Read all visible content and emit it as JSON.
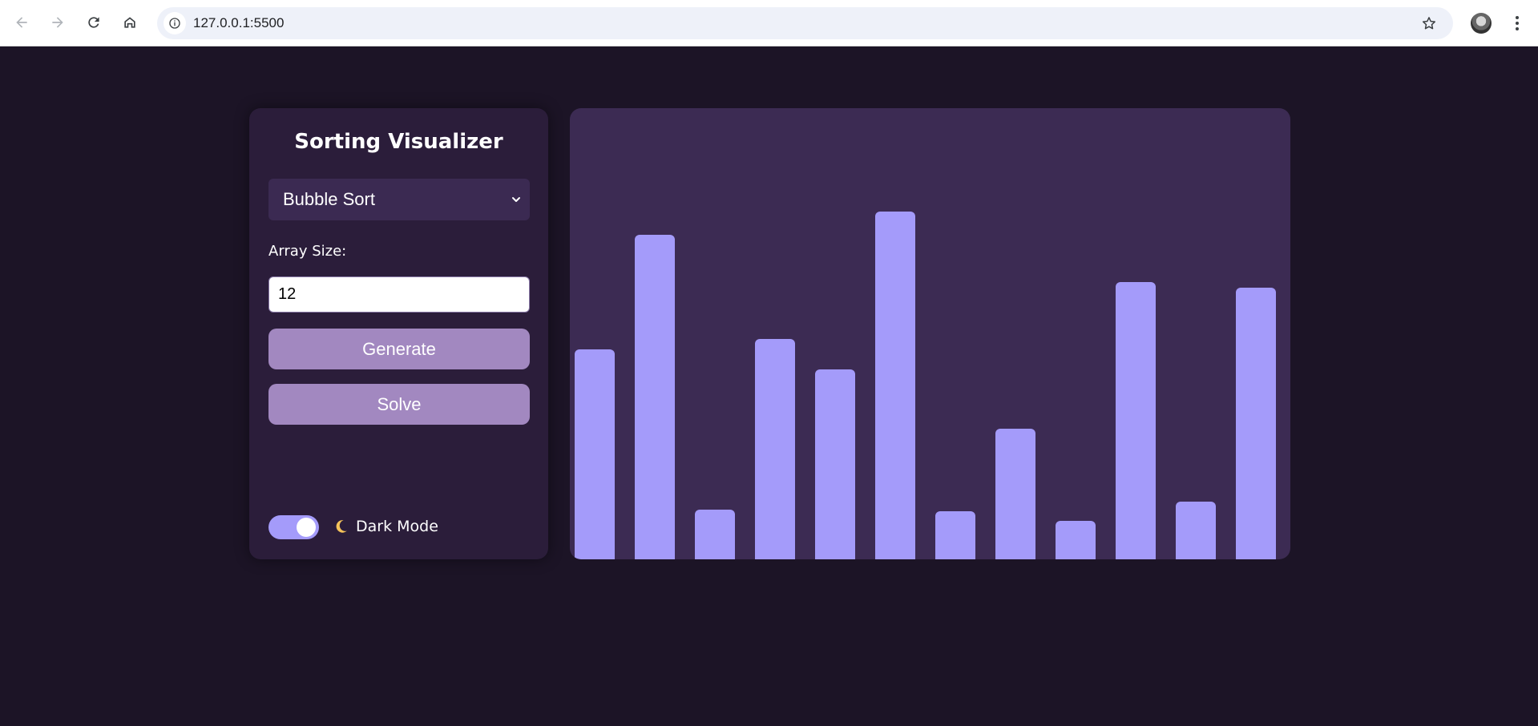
{
  "browser": {
    "url": "127.0.0.1:5500"
  },
  "panel": {
    "title": "Sorting Visualizer",
    "algorithm_selected": "Bubble Sort",
    "size_label": "Array Size:",
    "size_value": "12",
    "generate_label": "Generate",
    "solve_label": "Solve",
    "dark_mode_label": "Dark Mode",
    "dark_mode_on": true
  },
  "array": {
    "values": [
      262,
      405,
      62,
      275,
      237,
      434,
      60,
      163,
      48,
      346,
      72,
      339
    ],
    "max_value": 563,
    "bar_color": "#a49bfa"
  },
  "colors": {
    "page_background": "#1c1426",
    "panel_background": "#2b1d3a",
    "bars_background": "#3c2b53",
    "button_background": "#a288c0",
    "accent": "#a49bfa"
  }
}
